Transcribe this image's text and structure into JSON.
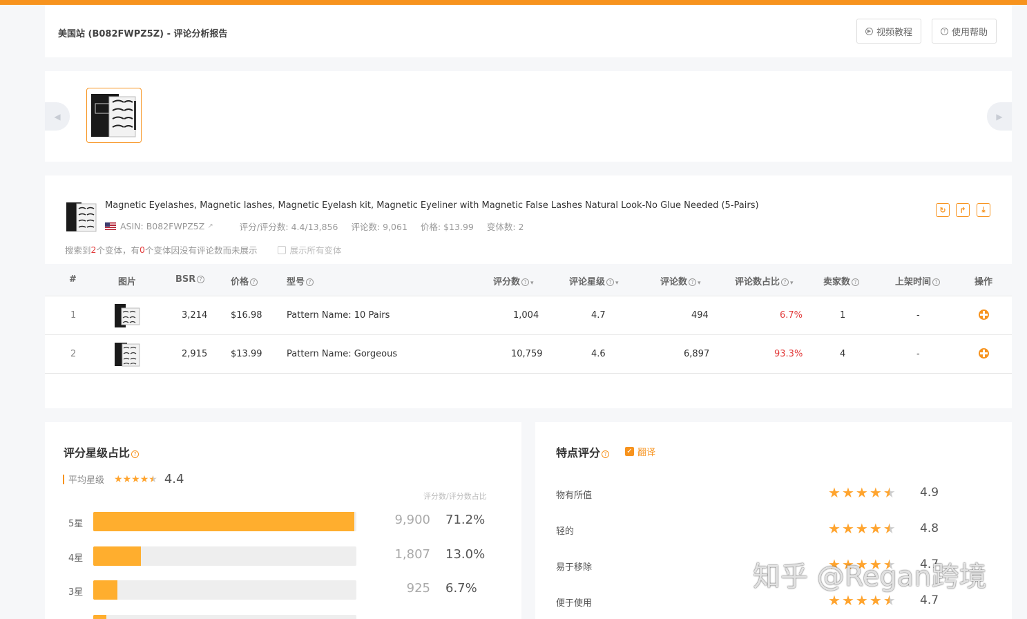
{
  "header": {
    "title": "美国站 (B082FWPZ5Z) - 评论分析报告",
    "video_btn": "视频教程",
    "help_btn": "使用帮助"
  },
  "product": {
    "title": "Magnetic Eyelashes, Magnetic lashes, Magnetic Eyelash kit, Magnetic Eyeliner with Magnetic False Lashes Natural Look-No Glue Needed (5-Pairs)",
    "asin": "ASIN: B082FWPZ5Z",
    "ratings": "评分/评分数: 4.4/13,856",
    "reviews": "评论数: 9,061",
    "price": "价格: $13.99",
    "variants": "变体数: 2",
    "note": {
      "p1": "搜索到",
      "n1": "2",
      "p2": "个变体，有",
      "n2": "0",
      "p3": "个变体因没有评论数而未展示",
      "show_all": "展示所有变体"
    }
  },
  "table": {
    "headers": {
      "idx": "#",
      "img": "图片",
      "bsr": "BSR",
      "price": "价格",
      "model": "型号",
      "ratings": "评分数",
      "stars": "评论星级",
      "reviews": "评论数",
      "share": "评论数占比",
      "sellers": "卖家数",
      "date": "上架时间",
      "ops": "操作"
    },
    "rows": [
      {
        "idx": "1",
        "bsr": "3,214",
        "price": "$16.98",
        "model": "Pattern Name: 10 Pairs",
        "ratings": "1,004",
        "stars": "4.7",
        "reviews": "494",
        "share": "6.7%",
        "sellers": "1",
        "date": "-"
      },
      {
        "idx": "2",
        "bsr": "2,915",
        "price": "$13.99",
        "model": "Pattern Name: Gorgeous",
        "ratings": "10,759",
        "stars": "4.6",
        "reviews": "6,897",
        "share": "93.3%",
        "sellers": "4",
        "date": "-"
      }
    ]
  },
  "rating_dist": {
    "title": "评分星级占比",
    "avg_label": "平均星级",
    "avg_value": "4.4",
    "avg_stars": 4.4,
    "col_head": "评分数/评分数占比",
    "rows": [
      {
        "label": "5星",
        "count": "9,900",
        "pct": "71.2%",
        "fill": 0.992
      },
      {
        "label": "4星",
        "count": "1,807",
        "pct": "13.0%",
        "fill": 0.18
      },
      {
        "label": "3星",
        "count": "925",
        "pct": "6.7%",
        "fill": 0.093
      },
      {
        "label": "",
        "count": "",
        "pct": "",
        "fill": 0.05
      }
    ]
  },
  "feature": {
    "title": "特点评分",
    "translate": "翻译",
    "rows": [
      {
        "label": "物有所值",
        "value": "4.9",
        "rating": 4.9
      },
      {
        "label": "轻的",
        "value": "4.8",
        "rating": 4.8
      },
      {
        "label": "易于移除",
        "value": "4.7",
        "rating": 4.7
      },
      {
        "label": "便于使用",
        "value": "4.7",
        "rating": 4.7
      }
    ]
  },
  "watermark": "知乎 @Regan跨境",
  "colors": {
    "accent": "#f7931e",
    "bar": "#ffae2e",
    "red": "#e23b3b"
  }
}
